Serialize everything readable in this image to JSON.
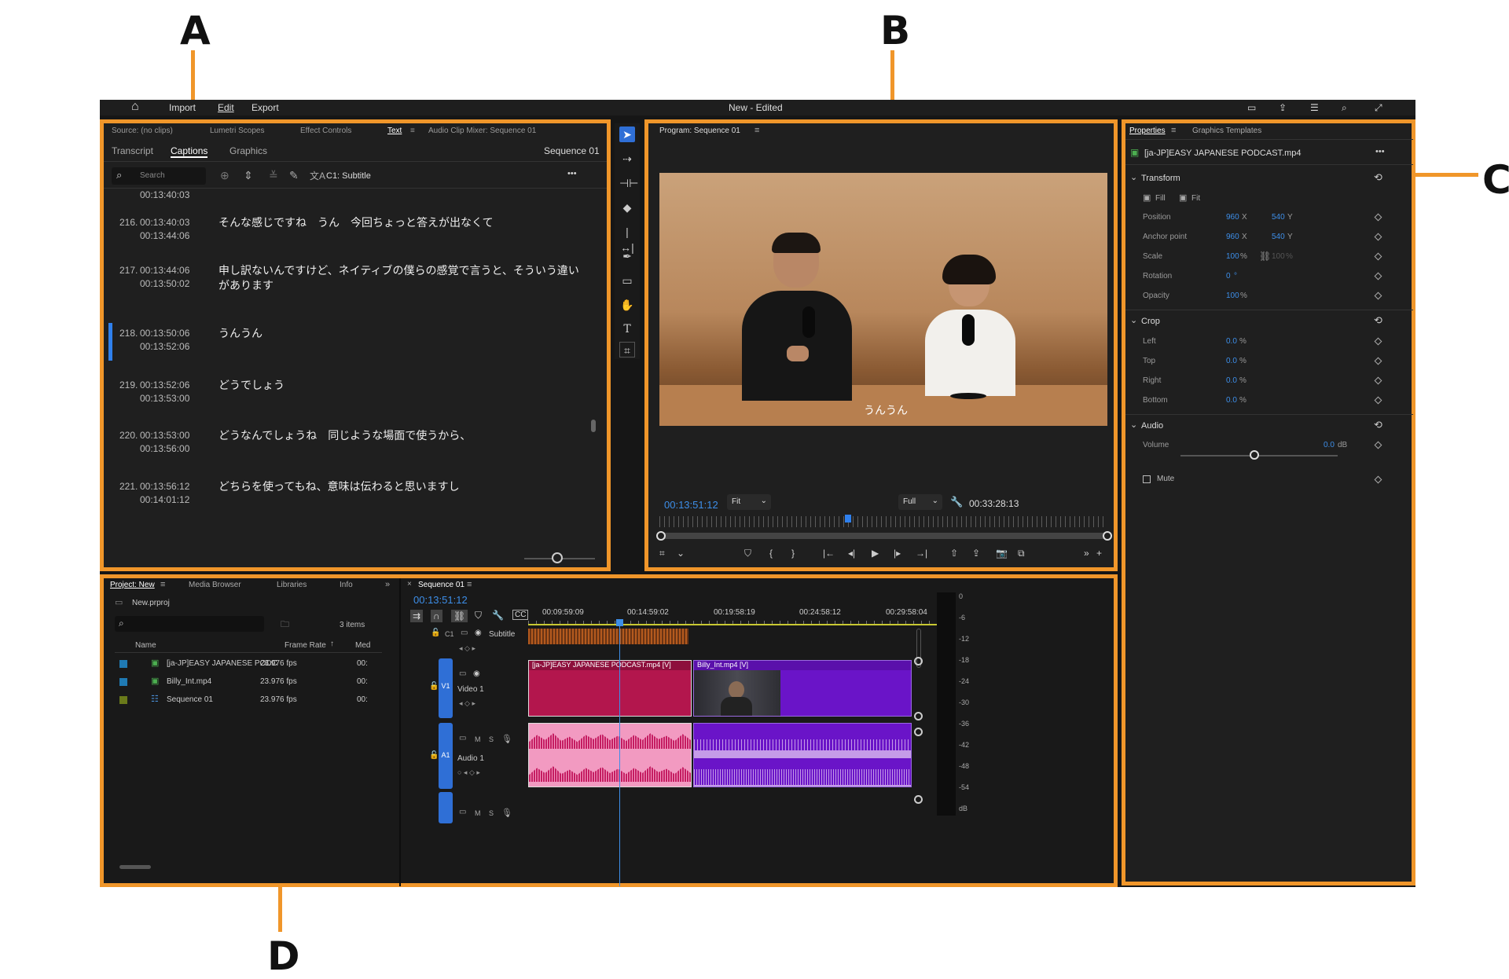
{
  "callouts": {
    "a": "A",
    "b": "B",
    "c": "C",
    "d": "D"
  },
  "menu": {
    "home": "⌂",
    "import": "Import",
    "edit": "Edit",
    "export": "Export",
    "title": "New - Edited"
  },
  "panelA": {
    "tabs": [
      "Source: (no clips)",
      "Lumetri Scopes",
      "Effect Controls",
      "Text",
      "Audio Clip Mixer: Sequence 01"
    ],
    "subtabs": [
      "Transcript",
      "Captions",
      "Graphics"
    ],
    "sequence": "Sequence 01",
    "search_placeholder": "Search",
    "track": "C1: Subtitle",
    "more": "•••",
    "captions": [
      {
        "num": "",
        "start": "00:13:40:03",
        "end": "",
        "text": ""
      },
      {
        "num": "216.",
        "start": "00:13:40:03",
        "end": "00:13:44:06",
        "text": "そんな感じですね　うん　今回ちょっと答えが出なくて"
      },
      {
        "num": "217.",
        "start": "00:13:44:06",
        "end": "00:13:50:02",
        "text": "申し訳ないんですけど、ネイティブの僕らの感覚で言うと、そういう違いがあります"
      },
      {
        "num": "218.",
        "start": "00:13:50:06",
        "end": "00:13:52:06",
        "text": "うんうん"
      },
      {
        "num": "219.",
        "start": "00:13:52:06",
        "end": "00:13:53:00",
        "text": "どうでしょう"
      },
      {
        "num": "220.",
        "start": "00:13:53:00",
        "end": "00:13:56:00",
        "text": "どうなんでしょうね　同じような場面で使うから、"
      },
      {
        "num": "221.",
        "start": "00:13:56:12",
        "end": "00:14:01:12",
        "text": "どちらを使ってもね、意味は伝わると思いますし"
      }
    ]
  },
  "panelB": {
    "title": "Program: Sequence 01",
    "subtitle_overlay": "うんうん",
    "timecode": "00:13:51:12",
    "fit": "Fit",
    "full": "Full",
    "duration": "00:33:28:13"
  },
  "panelC": {
    "tabs": [
      "Properties",
      "Graphics Templates"
    ],
    "clip": "[ja-JP]EASY JAPANESE PODCAST.mp4",
    "transform": "Transform",
    "fill": "Fill",
    "fitlabel": "Fit",
    "position": {
      "label": "Position",
      "x": "960",
      "y": "540"
    },
    "anchor": {
      "label": "Anchor point",
      "x": "960",
      "y": "540"
    },
    "scale": {
      "label": "Scale",
      "value": "100",
      "value2": "100"
    },
    "rotation": {
      "label": "Rotation",
      "value": "0"
    },
    "opacity": {
      "label": "Opacity",
      "value": "100"
    },
    "crop": "Crop",
    "crop_rows": [
      {
        "label": "Left",
        "value": "0.0"
      },
      {
        "label": "Top",
        "value": "0.0"
      },
      {
        "label": "Right",
        "value": "0.0"
      },
      {
        "label": "Bottom",
        "value": "0.0"
      }
    ],
    "audio": "Audio",
    "volume": {
      "label": "Volume",
      "value": "0.0"
    },
    "mute": "Mute",
    "units": {
      "x": "X",
      "y": "Y",
      "pct": "%",
      "deg": "°",
      "db": "dB"
    }
  },
  "panelD": {
    "tabs": [
      "Project: New",
      "Media Browser",
      "Libraries",
      "Info"
    ],
    "project_file": "New.prproj",
    "items_count": "3 items",
    "cols": [
      "Name",
      "Frame Rate",
      "Med"
    ],
    "items": [
      {
        "name": "[ja-JP]EASY JAPANESE PODC",
        "rate": "23.976 fps",
        "media": "00:",
        "color": "#1f7ab3"
      },
      {
        "name": "Billy_Int.mp4",
        "rate": "23.976 fps",
        "media": "00:",
        "color": "#1f7ab3"
      },
      {
        "name": "Sequence 01",
        "rate": "23.976 fps",
        "media": "00:",
        "color": "#6a7a1a"
      }
    ],
    "seq_tab": "Sequence 01",
    "timecode": "00:13:51:12",
    "ruler": [
      "00:09:59:09",
      "00:14:59:02",
      "00:19:58:19",
      "00:24:58:12",
      "00:29:58:04"
    ],
    "tracks": {
      "c1": "C1",
      "subtitle": "Subtitle",
      "v1": "V1",
      "video1": "Video 1",
      "a1": "A1",
      "audio1": "Audio 1",
      "m": "M",
      "s": "S"
    },
    "clip1": "[ja-JP]EASY JAPANESE PODCAST.mp4 [V]",
    "clip2": "Billy_Int.mp4 [V]",
    "meter": [
      "0",
      "-6",
      "-12",
      "-18",
      "-24",
      "-30",
      "-36",
      "-42",
      "-48",
      "-54",
      "dB"
    ]
  }
}
